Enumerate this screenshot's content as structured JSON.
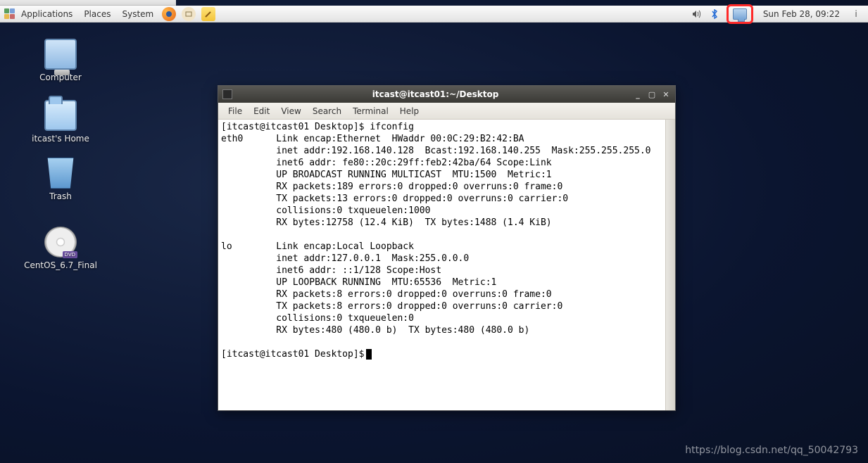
{
  "panel": {
    "menus": {
      "applications": "Applications",
      "places": "Places",
      "system": "System"
    },
    "clock": "Sun Feb 28, 09:22",
    "user_indicator": "i"
  },
  "desktop": {
    "computer": "Computer",
    "home": "itcast's Home",
    "trash": "Trash",
    "cd": "CentOS_6.7_Final"
  },
  "terminal": {
    "title": "itcast@itcast01:~/Desktop",
    "menus": {
      "file": "File",
      "edit": "Edit",
      "view": "View",
      "search": "Search",
      "terminal": "Terminal",
      "help": "Help"
    },
    "prompt1": "[itcast@itcast01 Desktop]$ ",
    "cmd1": "ifconfig",
    "eth0": {
      "name": "eth0",
      "l1": "Link encap:Ethernet  HWaddr 00:0C:29:B2:42:BA",
      "l2": "inet addr:192.168.140.128  Bcast:192.168.140.255  Mask:255.255.255.0",
      "l3": "inet6 addr: fe80::20c:29ff:feb2:42ba/64 Scope:Link",
      "l4": "UP BROADCAST RUNNING MULTICAST  MTU:1500  Metric:1",
      "l5": "RX packets:189 errors:0 dropped:0 overruns:0 frame:0",
      "l6": "TX packets:13 errors:0 dropped:0 overruns:0 carrier:0",
      "l7": "collisions:0 txqueuelen:1000",
      "l8": "RX bytes:12758 (12.4 KiB)  TX bytes:1488 (1.4 KiB)"
    },
    "lo": {
      "name": "lo",
      "l1": "Link encap:Local Loopback",
      "l2": "inet addr:127.0.0.1  Mask:255.0.0.0",
      "l3": "inet6 addr: ::1/128 Scope:Host",
      "l4": "UP LOOPBACK RUNNING  MTU:65536  Metric:1",
      "l5": "RX packets:8 errors:0 dropped:0 overruns:0 frame:0",
      "l6": "TX packets:8 errors:0 dropped:0 overruns:0 carrier:0",
      "l7": "collisions:0 txqueuelen:0",
      "l8": "RX bytes:480 (480.0 b)  TX bytes:480 (480.0 b)"
    },
    "prompt2": "[itcast@itcast01 Desktop]$"
  },
  "watermark": "https://blog.csdn.net/qq_50042793"
}
